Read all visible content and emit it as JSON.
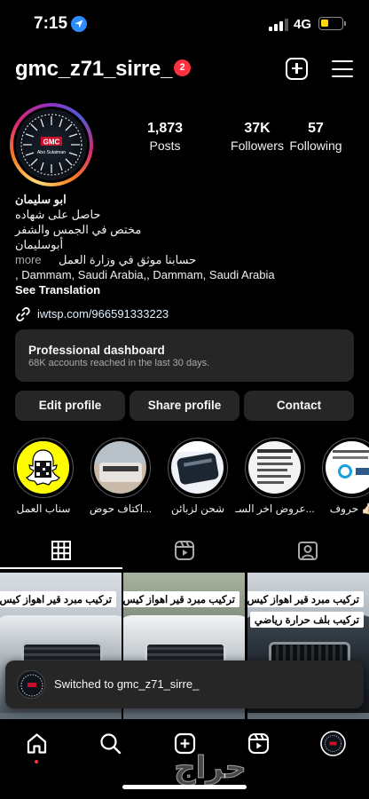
{
  "status_bar": {
    "time": "7:15",
    "network": "4G"
  },
  "header": {
    "username": "gmc_z71_sirre_",
    "notification_count": "2"
  },
  "profile": {
    "avatar_text_top": "GMC",
    "avatar_text_bottom": "Abo Sulaiman",
    "stats": [
      {
        "value": "1,873",
        "label": "Posts"
      },
      {
        "value": "37K",
        "label": "Followers"
      },
      {
        "value": "57",
        "label": "Following"
      }
    ],
    "bio": {
      "name": "ابو سليمان",
      "line1": "حاصل على شهاده",
      "line2": "مختص في الجمس والشفر",
      "line3": "أبوسليمان",
      "more": "more",
      "line4": "حسابنا موثق في وزارة العمل",
      "address": ", Dammam, Saudi Arabia,, Dammam, Saudi Arabia",
      "see_translation": "See Translation",
      "link": "iwtsp.com/966591333223"
    }
  },
  "dashboard": {
    "title": "Professional dashboard",
    "subtitle": "68K accounts reached in the last 30 days."
  },
  "actions": {
    "edit": "Edit profile",
    "share": "Share profile",
    "contact": "Contact"
  },
  "highlights": [
    {
      "label": "سناب العمل"
    },
    {
      "label": "اكتاف حوض..."
    },
    {
      "label": "شحن لزبائن"
    },
    {
      "label": "عروض اخر السـ..."
    },
    {
      "label": "حروف 👍🏻"
    }
  ],
  "posts": [
    {
      "caption": "تركيب مبرد قير اهواز كيس",
      "caption2": ""
    },
    {
      "caption": "تركيب مبرد قير اهواز كيس",
      "caption2": ""
    },
    {
      "caption": "تركيب مبرد قير اهواز كيس",
      "caption2": "تركيب بلف حرارة رياضي"
    }
  ],
  "toast": {
    "text": "Switched to gmc_z71_sirre_"
  },
  "watermark": {
    "text": "حراج"
  },
  "colors": {
    "background": "#000000",
    "card": "#262626",
    "badge": "#ff3040",
    "link": "#e0f1ff",
    "muted": "#a8a8a8"
  },
  "icons": [
    "location-arrow-icon",
    "signal-icon",
    "battery-icon",
    "new-post-icon",
    "menu-icon",
    "link-icon",
    "grid-icon",
    "reels-icon",
    "tagged-icon",
    "home-icon",
    "search-icon",
    "create-icon",
    "reels-nav-icon",
    "profile-icon"
  ]
}
